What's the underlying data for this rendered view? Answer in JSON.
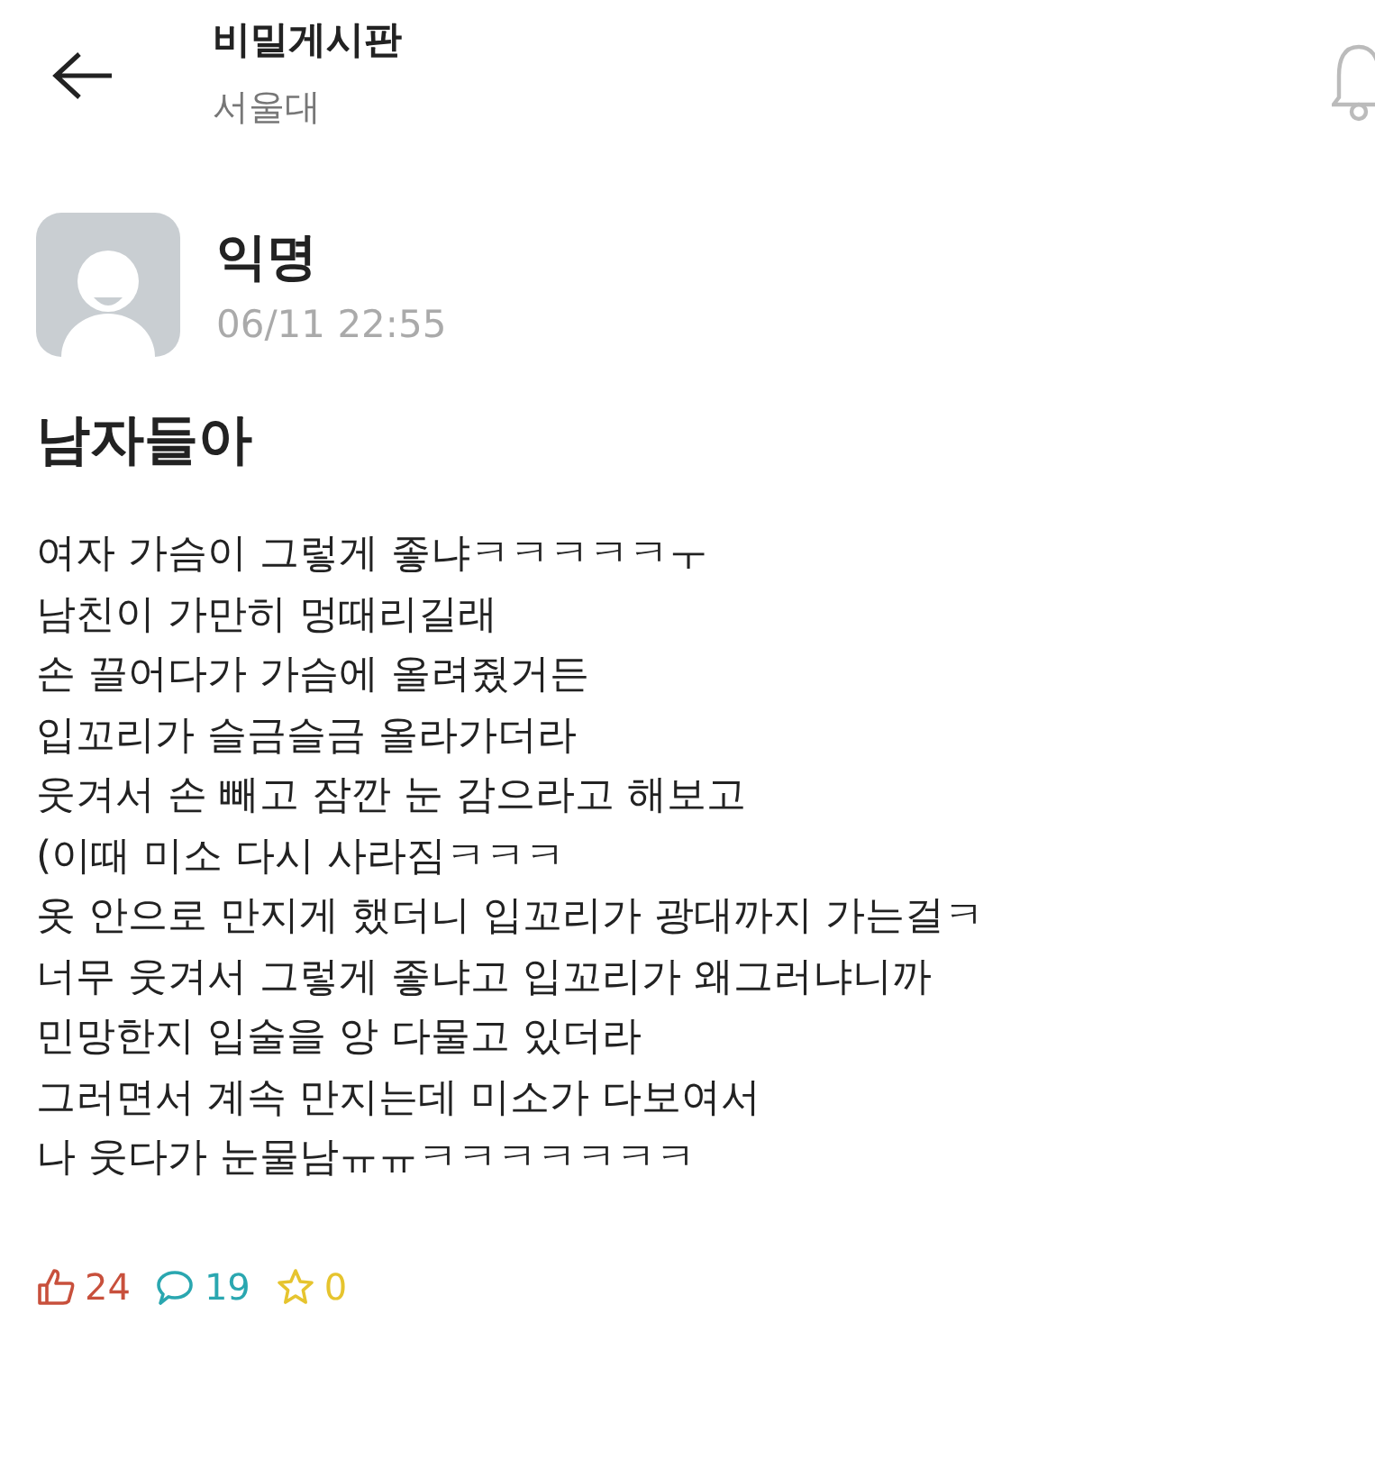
{
  "header": {
    "title": "비밀게시판",
    "subtitle": "서울대"
  },
  "post": {
    "author": "익명",
    "time": "06/11 22:55",
    "title": "남자들아",
    "body": [
      "여자 가슴이 그렇게 좋냐ㅋㅋㅋㅋㅋㅜ",
      "남친이 가만히 멍때리길래",
      "손 끌어다가 가슴에 올려줬거든",
      "입꼬리가 슬금슬금 올라가더라",
      "웃겨서 손 빼고 잠깐 눈 감으라고 해보고",
      "(이때 미소 다시 사라짐ㅋㅋㅋ",
      "옷 안으로 만지게 했더니 입꼬리가 광대까지 가는걸ㅋ",
      "너무 웃겨서 그렇게 좋냐고 입꼬리가 왜그러냐니까",
      "민망한지 입술을 앙 다물고 있더라",
      "그러면서 계속 만지는데 미소가 다보여서",
      "나 웃다가 눈물남ㅠㅠㅋㅋㅋㅋㅋㅋㅋ"
    ],
    "stats": [
      {
        "kind": "like",
        "count": "24",
        "color": "#c8503c"
      },
      {
        "kind": "comment",
        "count": "19",
        "color": "#2aa7b0"
      },
      {
        "kind": "scrap",
        "count": "0",
        "color": "#e6c42e"
      }
    ]
  }
}
